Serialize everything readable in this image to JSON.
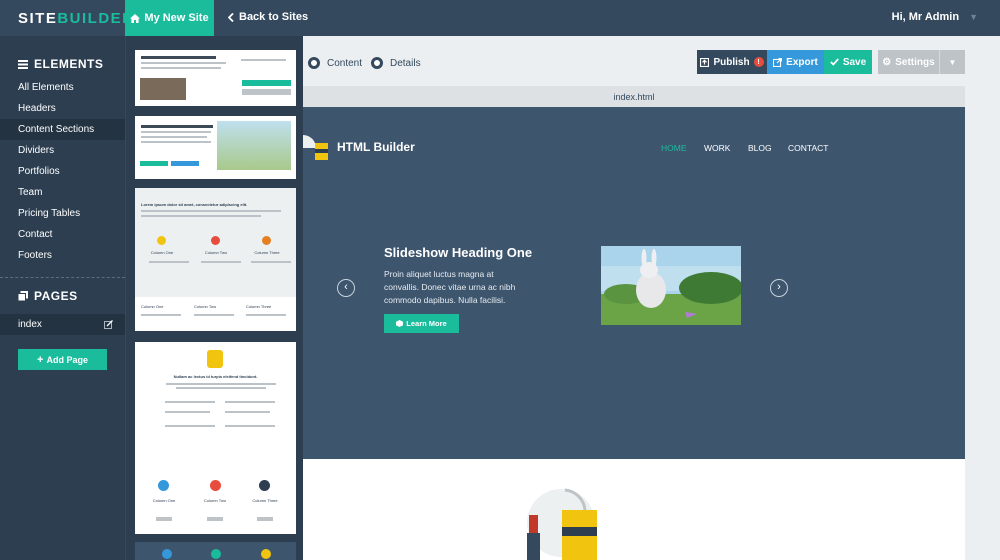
{
  "app": {
    "logo_primary": "SITE",
    "logo_secondary": "BUILDER",
    "site_tab": "My New Site",
    "back_link": "Back to Sites",
    "user": "Hi, Mr Admin"
  },
  "sidebar": {
    "elements_heading": "ELEMENTS",
    "items": [
      {
        "label": "All Elements"
      },
      {
        "label": "Headers"
      },
      {
        "label": "Content Sections"
      },
      {
        "label": "Dividers"
      },
      {
        "label": "Portfolios"
      },
      {
        "label": "Team"
      },
      {
        "label": "Pricing Tables"
      },
      {
        "label": "Contact"
      },
      {
        "label": "Footers"
      }
    ],
    "active_item": "Content Sections",
    "pages_heading": "PAGES",
    "page_name": "index",
    "add_page": "Add Page"
  },
  "toolbar": {
    "view_content": "Content",
    "view_details": "Details",
    "publish": "Publish",
    "publish_badge": "!",
    "export": "Export",
    "save": "Save",
    "settings": "Settings"
  },
  "thumbnails": {
    "t3_title": "Lorem ipsum dolor sit amet, consectetur adipiscing elit.",
    "t3_col1": "Column One",
    "t3_col2": "Column Two",
    "t3_col3": "Column Three",
    "t4_col1": "Column One",
    "t4_col2": "Column Two",
    "t4_col3": "Column Three",
    "t5_title": "Nullam ac lectus id turpis eleifend tincidunt.",
    "t6_col1": "Column One",
    "t6_col2": "Column Two",
    "t6_col3": "Column Three"
  },
  "canvas": {
    "filename": "index.html",
    "brand": "HTML Builder",
    "nav": [
      "HOME",
      "WORK",
      "BLOG",
      "CONTACT"
    ],
    "slide_title": "Slideshow Heading One",
    "slide_text": "Proin aliquet luctus magna at convallis. Donec vitae urna ac nibh commodo dapibus. Nulla facilisi.",
    "learn_more": "Learn More"
  },
  "colors": {
    "accent": "#1abc9c",
    "dark": "#2c3e50",
    "topbar": "#34495e",
    "blue": "#3498db",
    "hero": "#3e556e"
  }
}
